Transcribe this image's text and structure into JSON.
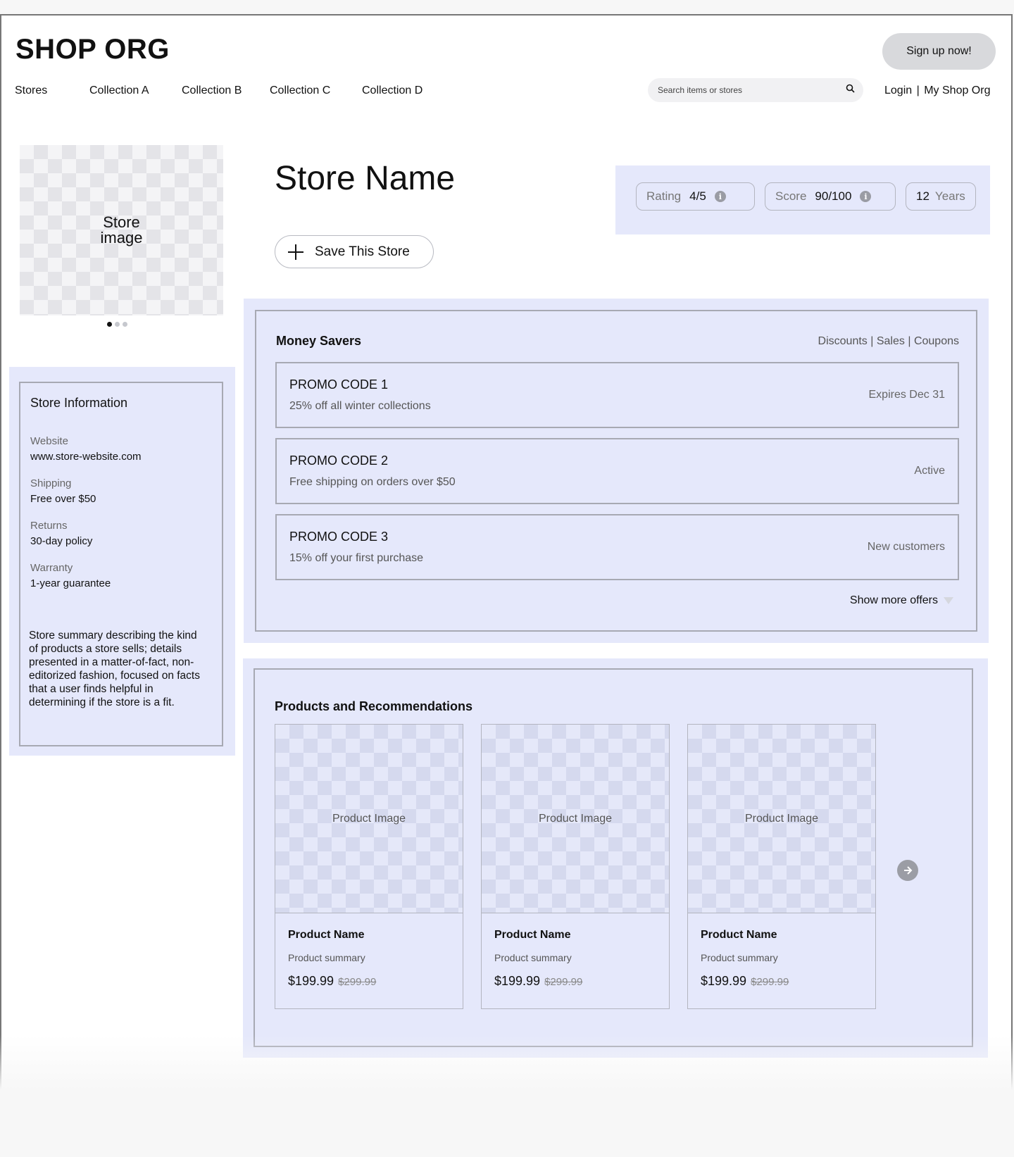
{
  "header": {
    "brand": "SHOP ORG",
    "signup_label": "Sign up now!",
    "nav": [
      "Stores",
      "Collection A",
      "Collection B",
      "Collection C",
      "Collection D"
    ],
    "search_placeholder": "Search items or stores",
    "login_label": "Login",
    "account_label": "My Shop Org"
  },
  "store": {
    "image_label": "Store image",
    "name": "Store Name",
    "save_label": "Save This Store",
    "carousel_dots": 3,
    "stats": {
      "rating_label": "Rating",
      "rating_value": "4/5",
      "score_label": "Score",
      "score_value": "90/100",
      "years_value": "12",
      "years_label": "Years"
    }
  },
  "info": {
    "title": "Store Information",
    "website_label": "Website",
    "website_value": "www.store-website.com",
    "shipping_label": "Shipping",
    "shipping_value": "Free over $50",
    "returns_label": "Returns",
    "returns_value": "30-day policy",
    "warranty_label": "Warranty",
    "warranty_value": "1-year guarantee",
    "summary": "Store summary describing the kind of products a store sells; details presented in a matter-of-fact, non-editorized fashion, focused on facts that a user finds helpful in determining if the store is a fit."
  },
  "money_savers": {
    "title": "Money Savers",
    "links": [
      "Discounts",
      "Sales",
      "Coupons"
    ],
    "promos": [
      {
        "code": "PROMO CODE 1",
        "desc": "25% off all winter collections",
        "meta": "Expires Dec 31"
      },
      {
        "code": "PROMO CODE 2",
        "desc": "Free shipping on orders over $50",
        "meta": "Active"
      },
      {
        "code": "PROMO CODE 3",
        "desc": "15% off your first purchase",
        "meta": "New customers"
      }
    ],
    "show_more": "Show more offers"
  },
  "products": {
    "title": "Products and Recommendations",
    "items": [
      {
        "image": "Product Image",
        "name": "Product Name",
        "summary": "Product summary",
        "price": "$199.99",
        "old_price": "$299.99"
      },
      {
        "image": "Product Image",
        "name": "Product Name",
        "summary": "Product summary",
        "price": "$199.99",
        "old_price": "$299.99"
      },
      {
        "image": "Product Image",
        "name": "Product Name",
        "summary": "Product summary",
        "price": "$199.99",
        "old_price": "$299.99"
      }
    ]
  },
  "icons": {
    "search": "search-icon",
    "info": "info-icon",
    "plus": "plus-icon",
    "next": "arrow-right-icon",
    "dropdown": "triangle-down-icon"
  },
  "colors": {
    "panel_bg": "#e5e8fb",
    "border": "#a7a9b3",
    "signup_bg": "#d8d9dc"
  }
}
